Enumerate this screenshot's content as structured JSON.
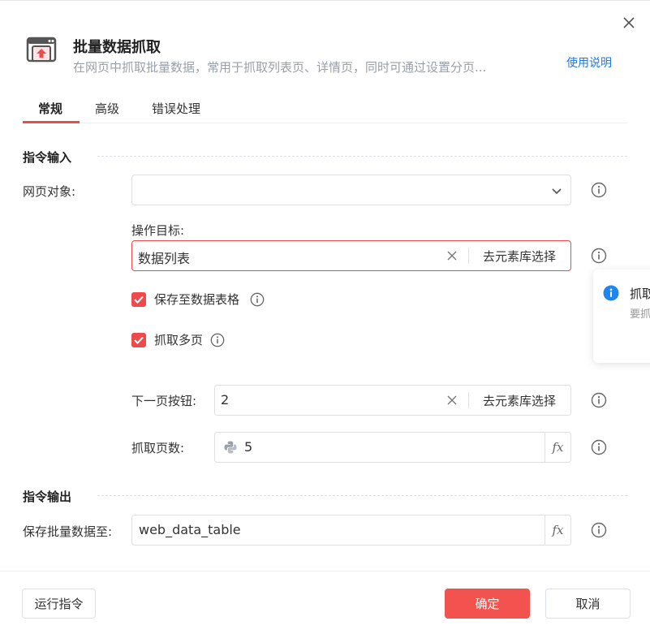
{
  "dialog": {
    "title": "批量数据抓取",
    "subtitle": "在网页中抓取批量数据，常用于抓取列表页、详情页，同时可通过设置分页...",
    "help_link": "使用说明"
  },
  "tabs": [
    {
      "label": "常规",
      "active": true
    },
    {
      "label": "高级",
      "active": false
    },
    {
      "label": "错误处理",
      "active": false
    }
  ],
  "input_section": {
    "title": "指令输入",
    "web_object": {
      "label": "网页对象:",
      "value": ""
    },
    "operation_target": {
      "label": "操作目标:",
      "value": "数据列表",
      "pick_label": "去元素库选择"
    },
    "save_to_table": {
      "label": "保存至数据表格",
      "checked": true
    },
    "grab_multi_page": {
      "label": "抓取多页",
      "checked": true
    },
    "next_page_button": {
      "label": "下一页按钮:",
      "value": "2",
      "pick_label": "去元素库选择"
    },
    "page_count": {
      "label": "抓取页数:",
      "value": "5",
      "fx": "fx"
    }
  },
  "output_section": {
    "title": "指令输出",
    "save_to": {
      "label": "保存批量数据至:",
      "value": "web_data_table",
      "fx": "fx"
    }
  },
  "tooltip": {
    "title": "抓取",
    "body": "要抓"
  },
  "footer": {
    "run_label": "运行指令",
    "confirm_label": "确定",
    "cancel_label": "取消"
  },
  "colors": {
    "accent": "#f0494b",
    "link": "#1f7ae0",
    "info_blue": "#1f86f0"
  }
}
